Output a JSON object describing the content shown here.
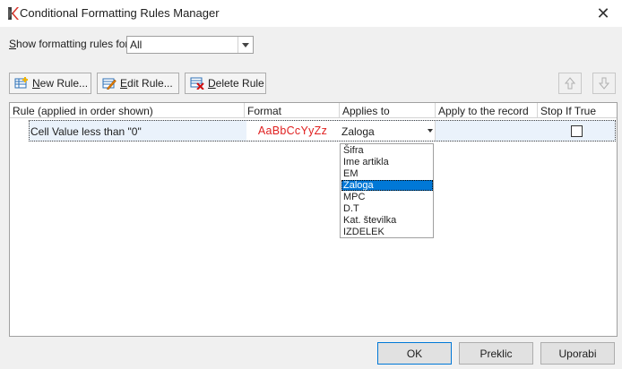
{
  "window": {
    "title": "Conditional Formatting Rules Manager",
    "close_glyph": "✕",
    "app_icon": "devexpress-icon"
  },
  "show_rules": {
    "label_prefix": "S",
    "label_rest": "how formatting rules for:",
    "selected": "All"
  },
  "toolbar": {
    "new_rule_u": "N",
    "new_rule_rest": "ew Rule...",
    "edit_rule_u": "E",
    "edit_rule_rest": "dit Rule...",
    "delete_rule_u": "D",
    "delete_rule_rest": "elete Rule"
  },
  "grid": {
    "columns": [
      "Rule (applied in order shown)",
      "Format",
      "Applies to",
      "Apply to the record",
      "Stop If True"
    ],
    "rows": [
      {
        "rule": "Cell Value less than \"0\"",
        "format_preview": "AaBbCcYyZz",
        "applies_to": "Zaloga",
        "apply_to_record": "",
        "stop_if_true": false
      }
    ]
  },
  "dropdown": {
    "items": [
      "Šifra",
      "Ime artikla",
      "EM",
      "Zaloga",
      "MPC",
      "D.T",
      "Kat. številka",
      "IZDELEK"
    ],
    "selected_index": 3
  },
  "footer": {
    "ok": "OK",
    "cancel": "Preklic",
    "apply": "Uporabi"
  },
  "colors": {
    "accent": "#0078d7",
    "format_text": "#e02020",
    "row_highlight": "#eaf2fb"
  }
}
